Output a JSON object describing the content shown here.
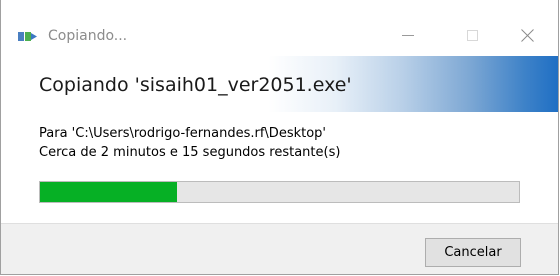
{
  "window": {
    "title": "Copiando..."
  },
  "header": {
    "title": "Copiando 'sisaih01_ver2051.exe'"
  },
  "body": {
    "destination": "Para 'C:\\Users\\rodrigo-fernandes.rf\\Desktop'",
    "time_remaining": "Cerca de 2 minutos e 15 segundos restante(s)"
  },
  "progress": {
    "fraction": 0.285,
    "fill_color": "#06b025",
    "track_color": "#e6e6e6"
  },
  "footer": {
    "cancel_label": "Cancelar"
  },
  "icons": {
    "app": "copy-icon",
    "minimize": "minimize-icon",
    "maximize": "maximize-icon",
    "close": "close-icon"
  }
}
